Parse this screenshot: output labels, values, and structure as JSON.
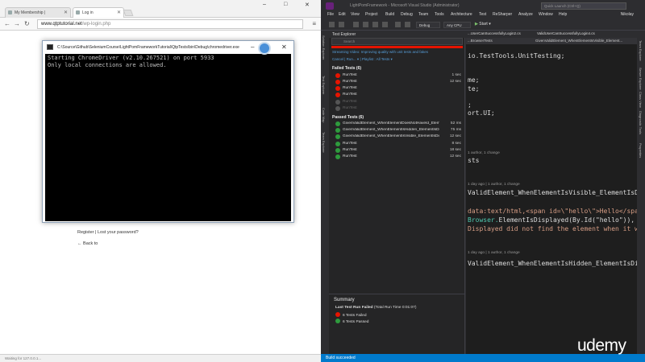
{
  "browser": {
    "tabs": [
      {
        "label": "My Membership |"
      },
      {
        "label": "Log in"
      }
    ],
    "window_controls": {
      "minimize": "–",
      "maximize": "□",
      "close": "✕"
    },
    "address": {
      "host": "www.qtptutorial.net",
      "path": "/wp-login.php"
    },
    "page": {
      "register_link": "Register",
      "separator": " | ",
      "lost_password_link": "Lost your password?",
      "back_link": "← Back to"
    },
    "status_text": "Waiting for 127.0.0.1..."
  },
  "console": {
    "title": "C:\\Source\\Github\\SeleniumCourse\\LightPomFrameworkTutorial\\QtpTests\\bin\\Debug\\chromedriver.exe",
    "lines": [
      "Starting ChromeDriver (v2.10.267521) on port 5933",
      "Only local connections are allowed."
    ],
    "controls": {
      "minimize": "–",
      "close": "✕"
    }
  },
  "vs": {
    "title": "LightPomFramework - Microsoft Visual Studio (Administrator)",
    "quick_launch": "Quick Launch (Ctrl+Q)",
    "menu": [
      "File",
      "Edit",
      "View",
      "Project",
      "Build",
      "Debug",
      "Team",
      "Tools",
      "Architecture",
      "Test",
      "ReSharper",
      "Analyze",
      "Window",
      "Help"
    ],
    "user": "Nikolay",
    "toolbar": {
      "config": "Debug",
      "platform": "Any CPU",
      "start": "Start"
    },
    "left_rail": [
      "Solution Explorer",
      "Test Explorer",
      "Code Map",
      "Team Explorer"
    ],
    "right_rail": [
      "Team Explorer",
      "Server Explorer",
      "Class View",
      "Diagnostic Tools",
      "Properties"
    ],
    "test_explorer": {
      "header": "Test Explorer",
      "search_placeholder": "Search",
      "banner": "Streaming Video: Improving quality with unit tests and fakes",
      "actions": "Cancel | Run... ▾ | Playlist : All Tests ▾",
      "failed_group": "Failed Tests (6)",
      "failed_tests": [
        {
          "name": "RunTest",
          "duration": "1 sec",
          "state": "fail"
        },
        {
          "name": "RunTest",
          "duration": "12 sec",
          "state": "fail"
        },
        {
          "name": "RunTest",
          "duration": "",
          "state": "fail"
        },
        {
          "name": "RunTest",
          "duration": "",
          "state": "fail"
        },
        {
          "name": "RunTest",
          "duration": "",
          "state": "skip"
        },
        {
          "name": "RunTest",
          "duration": "",
          "state": "skip"
        }
      ],
      "passed_group": "Passed Tests (6)",
      "passed_tests": [
        {
          "name": "GivenValidElement_WhenElementDoesNotHaveId_ElementIs...",
          "duration": "52 ms"
        },
        {
          "name": "GivenValidElement_WhenElementIsHidden_ElementIsDispla...",
          "duration": "75 ms"
        },
        {
          "name": "GivenValidElement_WhenElementIsVisible_ElementIsDisplaye...",
          "duration": "12 sec"
        },
        {
          "name": "RunTest",
          "duration": "8 sec"
        },
        {
          "name": "RunTest",
          "duration": "18 sec"
        },
        {
          "name": "RunTest",
          "duration": "12 sec"
        }
      ],
      "summary_title": "Summary",
      "summary_run": "Last Test Run Failed",
      "summary_time": "(Total Run Time 0:01:07)",
      "summary_failed": "6 Tests Failed",
      "summary_passed": "6 Tests Passed"
    },
    "editor": {
      "tabs": [
        "...UserCanSuccessfullyLogin2.cs",
        "ValidUserCanSuccessfullyLogin4.cs"
      ],
      "subbar": "...BrowserTests",
      "subbar2": "GivenValidElement_WhenElementIsVisible_Element...",
      "lines": {
        "l1": "io.TestTools.UnitTesting;",
        "l2": "me;",
        "l3": "te;",
        "l4": ";",
        "l5": "ort.UI;",
        "meta1": "1 author, 1 change",
        "l6": "sts",
        "meta2": "1 day ago | 1 author, 1 change",
        "l7": "ValidElement_WhenElementIsVisible_ElementIsD",
        "l8a": "data:text/html,<span id=\\\"hello\\\">Hello</span>",
        "l9a": "Browser.",
        "l9b": "ElementIsDisplayed(By.Id(\"hello\")),",
        "l10": "Displayed did not find the element when it was",
        "meta3": "1 day ago | 1 author, 1 change",
        "l11": "ValidElement_WhenElementIsHidden_ElementIsDispl"
      }
    },
    "status": "Build succeeded"
  },
  "watermark": "udemy",
  "colors": {
    "vs_accent": "#007acc",
    "fail": "#e51400",
    "pass": "#2e9b3d"
  }
}
